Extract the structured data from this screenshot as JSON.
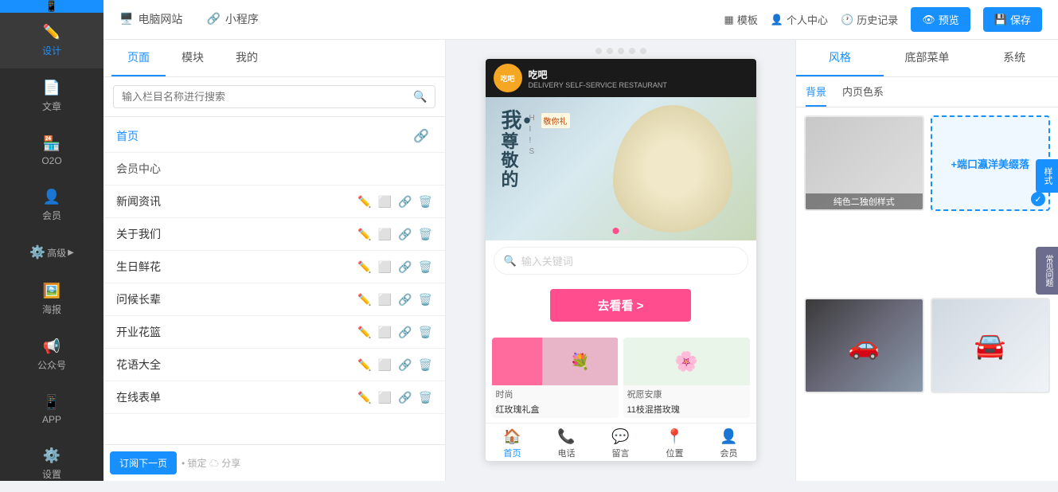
{
  "sidebar": {
    "logo_icon": "📱",
    "items": [
      {
        "label": "设计",
        "icon": "✏️",
        "id": "design",
        "active": true
      },
      {
        "label": "文章",
        "icon": "📄",
        "id": "article"
      },
      {
        "label": "O2O",
        "icon": "🏪",
        "id": "o2o"
      },
      {
        "label": "会员",
        "icon": "👤",
        "id": "member"
      },
      {
        "label": "高级",
        "icon": "⚙️",
        "id": "advanced",
        "has_arrow": true
      },
      {
        "label": "海报",
        "icon": "🖼️",
        "id": "poster"
      },
      {
        "label": "公众号",
        "icon": "📢",
        "id": "wechat"
      },
      {
        "label": "APP",
        "icon": "📱",
        "id": "app"
      },
      {
        "label": "设置",
        "icon": "⚙️",
        "id": "settings"
      }
    ]
  },
  "topbar": {
    "nav_items": [
      {
        "label": "电脑网站",
        "icon": "🖥️",
        "active": false
      },
      {
        "label": "小程序",
        "icon": "🔗",
        "active": false
      }
    ],
    "actions": [
      {
        "label": "模板",
        "icon": "▦"
      },
      {
        "label": "个人中心",
        "icon": "👤"
      },
      {
        "label": "历史记录",
        "icon": "🕐"
      }
    ],
    "preview_label": "预览",
    "save_label": "保存"
  },
  "left_panel": {
    "tabs": [
      {
        "label": "页面",
        "active": true
      },
      {
        "label": "模块",
        "active": false
      },
      {
        "label": "我的",
        "active": false
      }
    ],
    "search_placeholder": "输入栏目名称进行搜索",
    "nav_items": [
      {
        "name": "首页",
        "is_first": true,
        "show_share": true
      },
      {
        "name": "会员中心",
        "is_member": true
      },
      {
        "name": "新闻资讯",
        "show_actions": true
      },
      {
        "name": "关于我们",
        "show_actions": true
      },
      {
        "name": "生日鲜花",
        "show_actions": true
      },
      {
        "name": "问候长辈",
        "show_actions": true
      },
      {
        "name": "开业花篮",
        "show_actions": true
      },
      {
        "name": "花语大全",
        "show_actions": true
      },
      {
        "name": "在线表单",
        "show_actions": true
      }
    ],
    "bottom_button": "订阅下一页"
  },
  "phone_preview": {
    "store_name": "吃吧",
    "store_subtitle": "DELIVERY SELF-SERVICE RESTAURANT",
    "banner_main_text": "我•尊敬的",
    "banner_sub_text": "HI!S",
    "banner_sub_text2": "敬你礼",
    "search_placeholder": "输入关键词",
    "cta_button": "去看看 >",
    "products": [
      {
        "category": "时尚",
        "title": "红玫瑰礼盒",
        "subtitle": ""
      },
      {
        "category": "祝愿安康",
        "title": "11枝混搭玫瑰",
        "subtitle": ""
      }
    ],
    "footer_items": [
      {
        "label": "首页",
        "icon": "🏠",
        "active": true
      },
      {
        "label": "电话",
        "icon": "📞"
      },
      {
        "label": "留言",
        "icon": "💬"
      },
      {
        "label": "位置",
        "icon": "📍"
      },
      {
        "label": "会员",
        "icon": "👤"
      }
    ]
  },
  "right_panel": {
    "tabs": [
      {
        "label": "风格",
        "active": true
      },
      {
        "label": "底部菜单",
        "active": false
      },
      {
        "label": "系统",
        "active": false
      }
    ],
    "sub_tabs": [
      {
        "label": "背景",
        "active": true
      },
      {
        "label": "内页色系",
        "active": false
      }
    ],
    "style_items": [
      {
        "id": "plain",
        "label": "纯色二独创样式",
        "type": "plain"
      },
      {
        "id": "selected",
        "label": "+端口瀛洋美缀落",
        "type": "add",
        "selected": true
      },
      {
        "id": "car1",
        "label": "",
        "type": "car1"
      },
      {
        "id": "car2",
        "label": "",
        "type": "car2"
      }
    ]
  },
  "far_right": {
    "style_tab": "样式",
    "service_tab": "常见问题"
  }
}
